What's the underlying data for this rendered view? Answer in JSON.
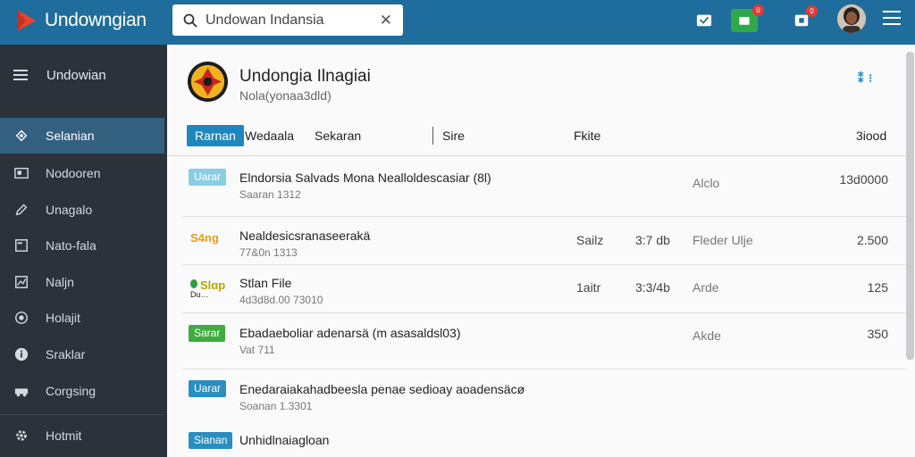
{
  "app": {
    "name": "Undowngian",
    "search_value": "Undowan Indansia",
    "notif_count_1": "0",
    "notif_count_2": "0"
  },
  "sidebar": {
    "header_label": "Undowian",
    "items": [
      {
        "label": "Selanian",
        "icon": "network-icon",
        "active": true
      },
      {
        "label": "Nodooren",
        "icon": "image-icon"
      },
      {
        "label": "Unagalo",
        "icon": "pencil-icon"
      },
      {
        "label": "Nato-fala",
        "icon": "document-icon"
      },
      {
        "label": "Naljn",
        "icon": "chart-icon"
      },
      {
        "label": "Holajit",
        "icon": "badge-icon"
      },
      {
        "label": "Sraklar",
        "icon": "info-icon"
      },
      {
        "label": "Corgsing",
        "icon": "car-icon"
      },
      {
        "label": "Hotmit",
        "icon": "gear-icon"
      }
    ]
  },
  "page": {
    "title": "Undongia Ilnagiai",
    "subtitle": "Nola(yonaa3dld)",
    "more_icon": "more-icon"
  },
  "tabs": [
    {
      "label": "Rarnan",
      "active": true
    },
    {
      "label": "Wedaala"
    },
    {
      "label": "Sekaran"
    }
  ],
  "columns": {
    "col1": "Sire",
    "col2": "Fkite",
    "col3": "3iood"
  },
  "rows": [
    {
      "tag": "Uarar",
      "tag_style": "light",
      "title": "Elndorsia Salvads Mona Nealloldescasiar (8l)",
      "sub": "Saaran 1312",
      "c1": "",
      "c2": "",
      "c3": "Alclo",
      "c4": "13d0000"
    },
    {
      "tag": "S4ng",
      "tag_style": "orange",
      "title": "Nealdesicsranaseerakä",
      "sub": "77&0n 1313",
      "c1": "Sailz",
      "c2": "3:7 db",
      "c3": "Fleder Ulje",
      "c4": "2.500"
    },
    {
      "tag": "Slɑp",
      "tag_style": "yg",
      "tag2": "Du…",
      "title": "Stlan File",
      "sub": "4d3d8d.00 73010",
      "c1": "1aitr",
      "c2": "3:3/4b",
      "c3": "Arde",
      "c4": "125"
    },
    {
      "tag": "Sarar",
      "tag_style": "green",
      "title": "Ebadaeboliar adenarsä (m asasaldsl03)",
      "sub": "Vat 711",
      "c1": "",
      "c2": "",
      "c3": "Akde",
      "c4": "350"
    },
    {
      "tag": "Uarar",
      "tag_style": "blue",
      "title": "Enedaraiakahadbeesla penae sedioay aoadensäcø",
      "sub": "Soanan 1.3301",
      "c1": "",
      "c2": "",
      "c3": "",
      "c4": ""
    },
    {
      "tag": "Sianan",
      "tag_style": "blue",
      "title": "Unhidlnaiagloan",
      "sub": "",
      "c1": "",
      "c2": "",
      "c3": "",
      "c4": ""
    }
  ]
}
